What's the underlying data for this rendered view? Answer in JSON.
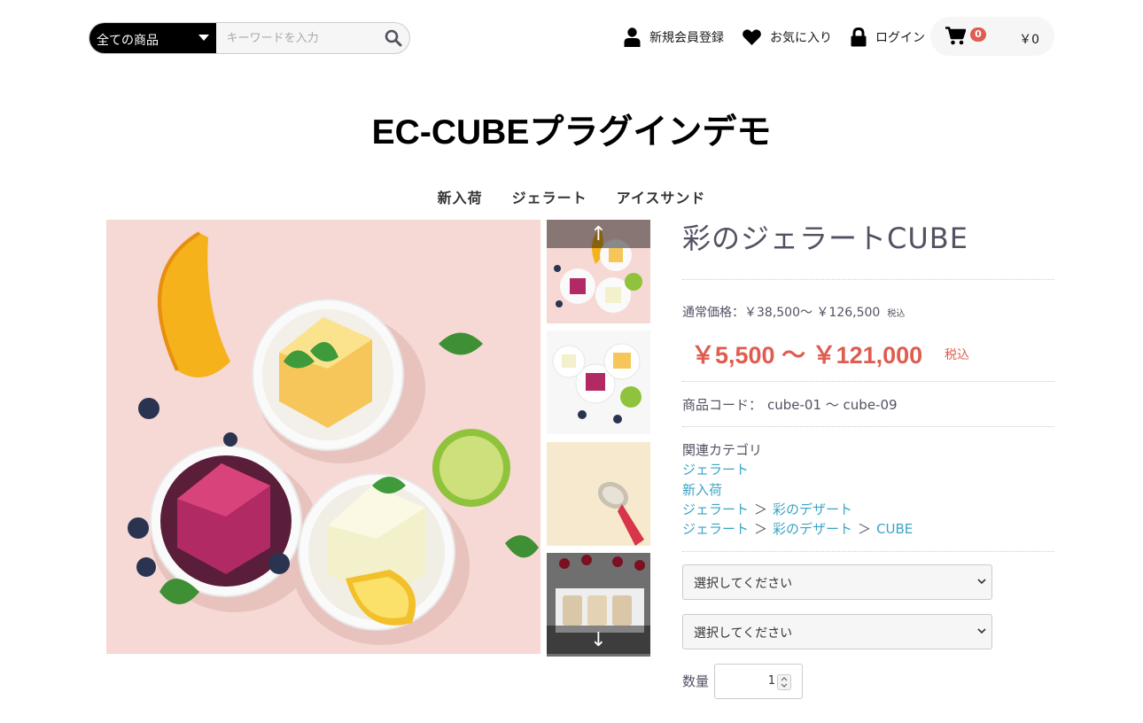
{
  "header": {
    "category_select": "全ての商品",
    "search_placeholder": "キーワードを入力",
    "register": "新規会員登録",
    "favorite": "お気に入り",
    "login": "ログイン",
    "cart_count": "0",
    "cart_total": "￥0"
  },
  "site_title": "EC-CUBEプラグインデモ",
  "global_nav": [
    "新入荷",
    "ジェラート",
    "アイスサンド"
  ],
  "gallery": {
    "arrow_up": "↑",
    "arrow_down": "↓"
  },
  "product": {
    "name": "彩のジェラートCUBE",
    "normal_price_label": "通常価格：",
    "normal_price": "￥38,500〜 ￥126,500",
    "normal_tax": "税込",
    "sale_price": "￥5,500 〜 ￥121,000",
    "sale_tax": "税込",
    "code_label": "商品コード：",
    "code": "cube-01 〜 cube-09",
    "related_label": "関連カテゴリ",
    "related": {
      "line1": [
        "ジェラート"
      ],
      "line2": [
        "新入荷"
      ],
      "line3": [
        "ジェラート",
        "彩のデザート"
      ],
      "line4": [
        "ジェラート",
        "彩のデザート",
        "CUBE"
      ]
    },
    "separator": "＞",
    "select1": "選択してください",
    "select2": "選択してください",
    "qty_label": "数量",
    "qty_value": "1"
  },
  "colors": {
    "price_red": "#de5d50",
    "link_blue": "#3aa3c4",
    "text": "#525263"
  }
}
